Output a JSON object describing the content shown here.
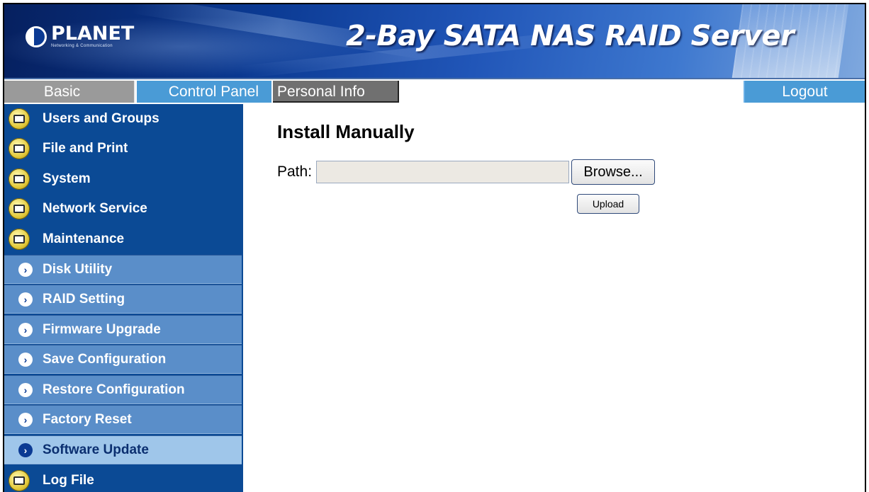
{
  "header": {
    "logo_name": "PLANET",
    "logo_tagline": "Networking & Communication",
    "title": "2-Bay SATA NAS RAID Server"
  },
  "tabs": {
    "basic": "Basic",
    "control_panel": "Control Panel",
    "personal_info": "Personal Info",
    "logout": "Logout"
  },
  "sidebar": {
    "items": [
      {
        "label": "Users and Groups",
        "type": "category",
        "icon": "folder-icon"
      },
      {
        "label": "File and Print",
        "type": "category",
        "icon": "folder-icon"
      },
      {
        "label": "System",
        "type": "category",
        "icon": "folder-icon"
      },
      {
        "label": "Network Service",
        "type": "category",
        "icon": "folder-icon"
      },
      {
        "label": "Maintenance",
        "type": "category",
        "icon": "folder-icon"
      },
      {
        "label": "Disk Utility",
        "type": "subitem",
        "icon": "chevron-right-icon"
      },
      {
        "label": "RAID Setting",
        "type": "subitem",
        "icon": "chevron-right-icon"
      },
      {
        "label": "Firmware Upgrade",
        "type": "subitem",
        "icon": "chevron-right-icon"
      },
      {
        "label": "Save Configuration",
        "type": "subitem",
        "icon": "chevron-right-icon"
      },
      {
        "label": "Restore Configuration",
        "type": "subitem",
        "icon": "chevron-right-icon"
      },
      {
        "label": "Factory Reset",
        "type": "subitem",
        "icon": "chevron-right-icon"
      },
      {
        "label": "Software Update",
        "type": "subitem",
        "icon": "chevron-right-icon",
        "active": true
      },
      {
        "label": "Log File",
        "type": "category",
        "icon": "folder-icon"
      }
    ]
  },
  "main": {
    "title": "Install Manually",
    "path_label": "Path:",
    "path_value": "",
    "browse_label": "Browse...",
    "upload_label": "Upload"
  },
  "colors": {
    "sidebar_bg": "#0b4a95",
    "subitem_bg": "#5a8ec9",
    "active_bg": "#9fc6ea",
    "tab_active": "#4a9bd6"
  }
}
